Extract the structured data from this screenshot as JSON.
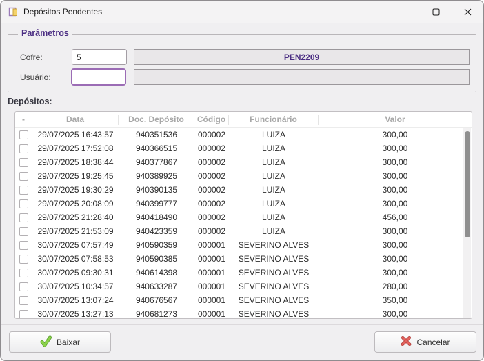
{
  "window": {
    "title": "Depósitos Pendentes"
  },
  "parameters": {
    "group_label": "Parâmetros",
    "cofre_label": "Cofre:",
    "cofre_value": "5",
    "cofre_display": "PEN2209",
    "usuario_label": "Usuário:",
    "usuario_value": "",
    "usuario_display": ""
  },
  "deposits": {
    "label": "Depósitos:",
    "columns": [
      "-",
      "Data",
      "Doc. Depósito",
      "Código",
      "Funcionário",
      "Valor"
    ],
    "rows": [
      {
        "date": "29/07/2025 16:43:57",
        "doc": "940351536",
        "code": "000002",
        "employee": "LUIZA",
        "value": "300,00"
      },
      {
        "date": "29/07/2025 17:52:08",
        "doc": "940366515",
        "code": "000002",
        "employee": "LUIZA",
        "value": "300,00"
      },
      {
        "date": "29/07/2025 18:38:44",
        "doc": "940377867",
        "code": "000002",
        "employee": "LUIZA",
        "value": "300,00"
      },
      {
        "date": "29/07/2025 19:25:45",
        "doc": "940389925",
        "code": "000002",
        "employee": "LUIZA",
        "value": "300,00"
      },
      {
        "date": "29/07/2025 19:30:29",
        "doc": "940390135",
        "code": "000002",
        "employee": "LUIZA",
        "value": "300,00"
      },
      {
        "date": "29/07/2025 20:08:09",
        "doc": "940399777",
        "code": "000002",
        "employee": "LUIZA",
        "value": "300,00"
      },
      {
        "date": "29/07/2025 21:28:40",
        "doc": "940418490",
        "code": "000002",
        "employee": "LUIZA",
        "value": "456,00"
      },
      {
        "date": "29/07/2025 21:53:09",
        "doc": "940423359",
        "code": "000002",
        "employee": "LUIZA",
        "value": "300,00"
      },
      {
        "date": "30/07/2025 07:57:49",
        "doc": "940590359",
        "code": "000001",
        "employee": "SEVERINO ALVES",
        "value": "300,00"
      },
      {
        "date": "30/07/2025 07:58:53",
        "doc": "940590385",
        "code": "000001",
        "employee": "SEVERINO ALVES",
        "value": "300,00"
      },
      {
        "date": "30/07/2025 09:30:31",
        "doc": "940614398",
        "code": "000001",
        "employee": "SEVERINO ALVES",
        "value": "300,00"
      },
      {
        "date": "30/07/2025 10:34:57",
        "doc": "940633287",
        "code": "000001",
        "employee": "SEVERINO ALVES",
        "value": "280,00"
      },
      {
        "date": "30/07/2025 13:07:24",
        "doc": "940676567",
        "code": "000001",
        "employee": "SEVERINO ALVES",
        "value": "350,00"
      },
      {
        "date": "30/07/2025 13:27:13",
        "doc": "940681273",
        "code": "000001",
        "employee": "SEVERINO ALVES",
        "value": "300,00"
      }
    ]
  },
  "footer": {
    "baixar_label": "Baixar",
    "cancelar_label": "Cancelar"
  },
  "colors": {
    "accent_purple": "#4b2e83",
    "focus_border": "#9b6cb5",
    "check_green": "#76c043",
    "cancel_red": "#d64541"
  }
}
